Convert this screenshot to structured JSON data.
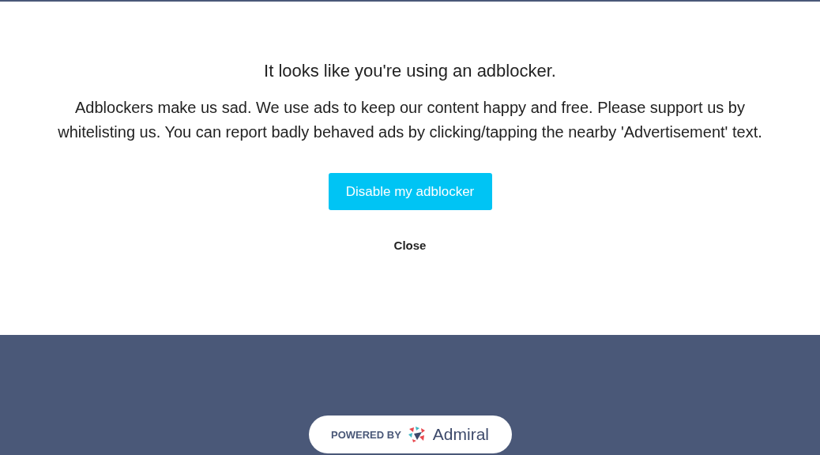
{
  "dialog": {
    "title": "It looks like you're using an adblocker.",
    "message": "Adblockers make us sad. We use ads to keep our content happy and free. Please support us by whitelisting us. You can report badly behaved ads by clicking/tapping the nearby 'Advertisement' text.",
    "primary_button": "Disable my adblocker",
    "close_link": "Close"
  },
  "footer": {
    "badge": {
      "prefix": "POWERED BY",
      "brand": "Admiral"
    }
  }
}
